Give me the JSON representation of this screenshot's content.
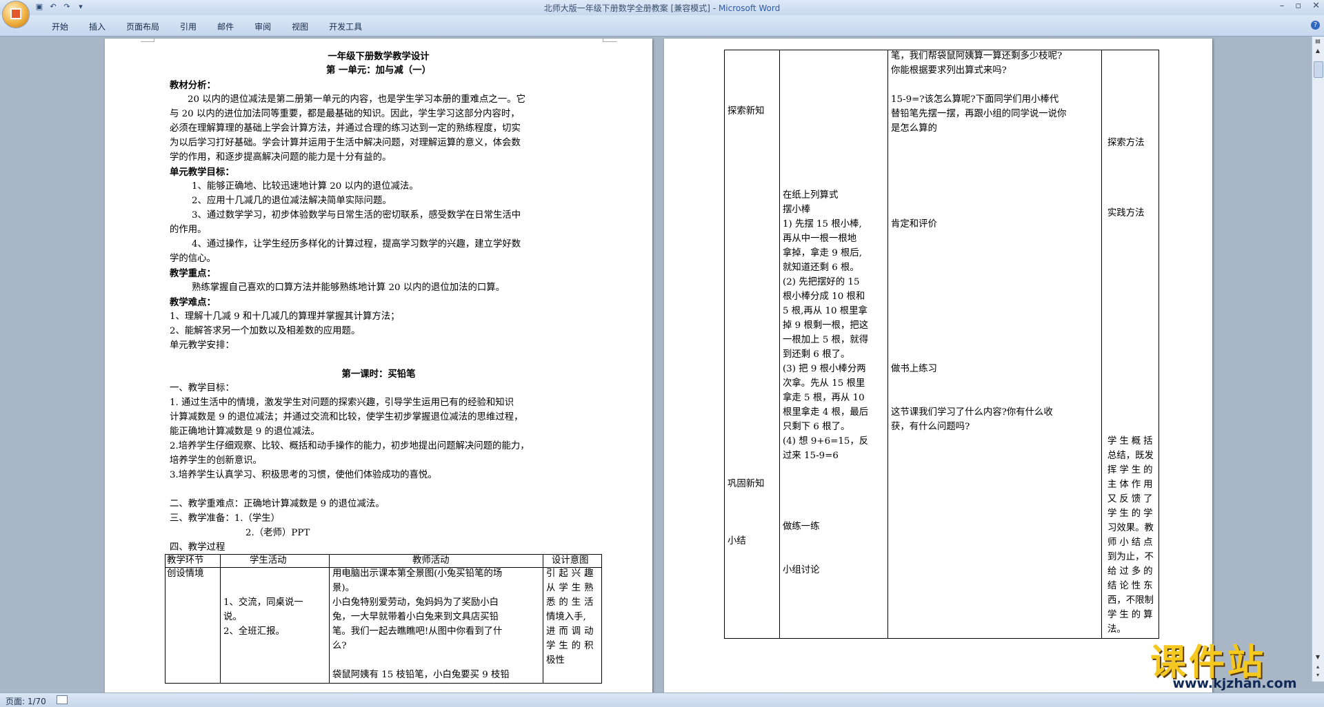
{
  "window": {
    "title": "北师大版一年级下册数学全册教案 [兼容模式]",
    "app_name": "Microsoft Word"
  },
  "quick_access": [
    "save-icon",
    "undo-icon",
    "redo-icon",
    "customize-icon"
  ],
  "menu": [
    "开始",
    "插入",
    "页面布局",
    "引用",
    "邮件",
    "审阅",
    "视图",
    "开发工具"
  ],
  "status": {
    "page": "页面: 1/70"
  },
  "watermark": {
    "brand": "课件站",
    "url": "www.kjzhan.com"
  },
  "page1": {
    "title": "一年级下册数学教学设计",
    "unit": "第 一单元：加与减（一）",
    "analysis_head": "教材分析：",
    "analysis": [
      "20 以内的退位减法是第二册第一单元的内容，也是学生学习本册的重难点之一。它",
      "与 20 以内的进位加法同等重要，都是最基础的知识。因此，学生学习这部分内容时，",
      "必须在理解算理的基础上学会计算方法，并通过合理的练习达到一定的熟练程度，切实",
      "为以后学习打好基础。学会计算并运用于生活中解决问题，对理解运算的意义，体会数",
      "学的作用，和逐步提高解决问题的能力是十分有益的。"
    ],
    "goals_head": "单元教学目标：",
    "goals": [
      "1、能够正确地、比较迅速地计算 20 以内的退位减法。",
      "2、应用十几减几的退位减法解决简单实际问题。",
      "3、通过数学学习，初步体验数学与日常生活的密切联系，感受数学在日常生活中",
      "的作用。",
      "4、通过操作，让学生经历多样化的计算过程，提高学习数学的兴趣，建立学好数",
      "学的信心。"
    ],
    "key_head": "教学重点：",
    "key": "熟练掌握自己喜欢的口算方法并能够熟练地计算 20 以内的退位加法的口算。",
    "diff_head": "教学难点：",
    "diff": [
      "1、理解十几减 9 和十几减几的算理并掌握其计算方法；",
      "2、能解答求另一个加数以及相差数的应用题。"
    ],
    "arrange": "单元教学安排：",
    "lesson_title": "第一课时：买铅笔",
    "lg_head": "一、教学目标：",
    "lg": [
      "1. 通过生活中的情境，激发学生对问题的探索兴趣，引导学生运用已有的经验和知识",
      "计算减数是 9 的退位减法；并通过交流和比较，使学生初步掌握退位减法的思维过程，",
      "能正确地计算减数是 9 的退位减法。",
      "2.培养学生仔细观察、比较、概括和动手操作的能力，初步地提出问题解决问题的能力，",
      "培养学生的创新意识。",
      "3.培养学生认真学习、积极思考的习惯，使他们体验成功的喜悦。"
    ],
    "kd": "二、教学重难点：正确地计算减数是 9 的退位减法。",
    "prep1": "三、教学准备：1.（学生）",
    "prep2": "2.（老师）PPT",
    "process": "四、教学过程",
    "table_head": [
      "教学环节",
      "学生活动",
      "教师活动",
      "设计意图"
    ],
    "row_stage": "创设情境",
    "row_student": [
      "1、交流，同桌说一",
      "说。",
      "2、全班汇报。"
    ],
    "row_teacher": [
      "用电脑出示课本第全景图(小兔买铅笔的场",
      "景)。",
      "小白兔特别爱劳动，兔妈妈为了奖励小白",
      "兔，一大早就带着小白兔来到文具店买铅",
      "笔。我们一起去瞧瞧吧!从图中你看到了什",
      "么?",
      "",
      "袋鼠阿姨有 15 枝铅笔，小白兔要买 9 枝铅"
    ],
    "row_design": [
      "引起兴趣",
      "从学生熟",
      "悉的生活",
      "情境入手,",
      "进而调动",
      "学生的积",
      "极性"
    ]
  },
  "page2": {
    "c1": [
      "探索新知",
      "巩固新知",
      "小结"
    ],
    "c2": [
      "在纸上列算式",
      "摆小棒",
      "1) 先摆 15 根小棒,",
      "再从中一根一根地",
      "拿掉，拿走 9 根后,",
      "就知道还剩 6 根。",
      "(2) 先把摆好的 15",
      "根小棒分成 10 根和",
      "5 根,再从 10 根里拿",
      "掉 9 根剩一根，把这",
      "一根加上 5 根，就得",
      "到还剩 6 根了。",
      "(3) 把 9 根小棒分两",
      "次拿。先从 15 根里",
      "拿走 5 根，再从 10",
      "根里拿走 4 根，最后",
      "只剩下 6 根了。",
      "(4) 想 9+6=15，反",
      "过来 15-9=6",
      "做练一练",
      "小组讨论"
    ],
    "c3": [
      "笔，我们帮袋鼠阿姨算一算还剩多少枝呢?",
      "你能根据要求列出算式来吗?",
      "15-9=?该怎么算呢?下面同学们用小棒代",
      "替铅笔先摆一摆，再跟小组的同学说一说你",
      "是怎么算的",
      "肯定和评价",
      "做书上练习",
      "这节课我们学习了什么内容?你有什么收",
      "获，有什么问题吗?"
    ],
    "c4": [
      "探索方法",
      "实践方法",
      "学生概括",
      "总结，既发",
      "挥学生的",
      "主体作用",
      "又反馈了",
      "学生的学",
      "习效果。教",
      "师小结点",
      "到为止，不",
      "给过多的",
      "结论性东",
      "西，不限制",
      "学生的算",
      "法。"
    ]
  }
}
